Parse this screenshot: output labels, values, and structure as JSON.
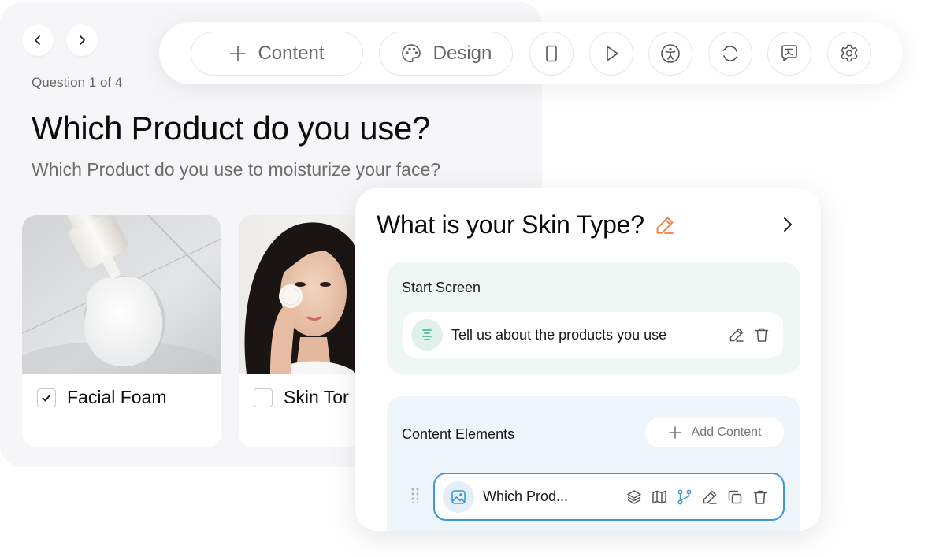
{
  "preview": {
    "question_counter": "Question 1 of 4",
    "title": "Which Product do you use?",
    "subtitle": "Which Product do you use to moisturize your face?",
    "options": [
      {
        "label": "Facial Foam",
        "checked": true,
        "image": "foam-photo"
      },
      {
        "label": "Skin Tor",
        "checked": false,
        "image": "woman-applying-toner-photo"
      }
    ]
  },
  "toolbar": {
    "content_label": "Content",
    "design_label": "Design",
    "icon_buttons": [
      "mobile-preview-icon",
      "play-icon",
      "accessibility-icon",
      "refresh-icon",
      "translate-icon",
      "settings-icon"
    ]
  },
  "editor": {
    "title": "What is your Skin Type?",
    "start_screen": {
      "title": "Start Screen",
      "item_text": "Tell us about the products you use"
    },
    "content_elements": {
      "title": "Content Elements",
      "add_label": "Add Content",
      "item_text": "Which Prod..."
    }
  },
  "colors": {
    "accent_orange": "#f07a3c",
    "accent_blue": "#3b9ad6",
    "accent_green": "#3aa98a",
    "start_section_bg": "#eef7f4",
    "content_section_bg": "#eef5fb"
  }
}
